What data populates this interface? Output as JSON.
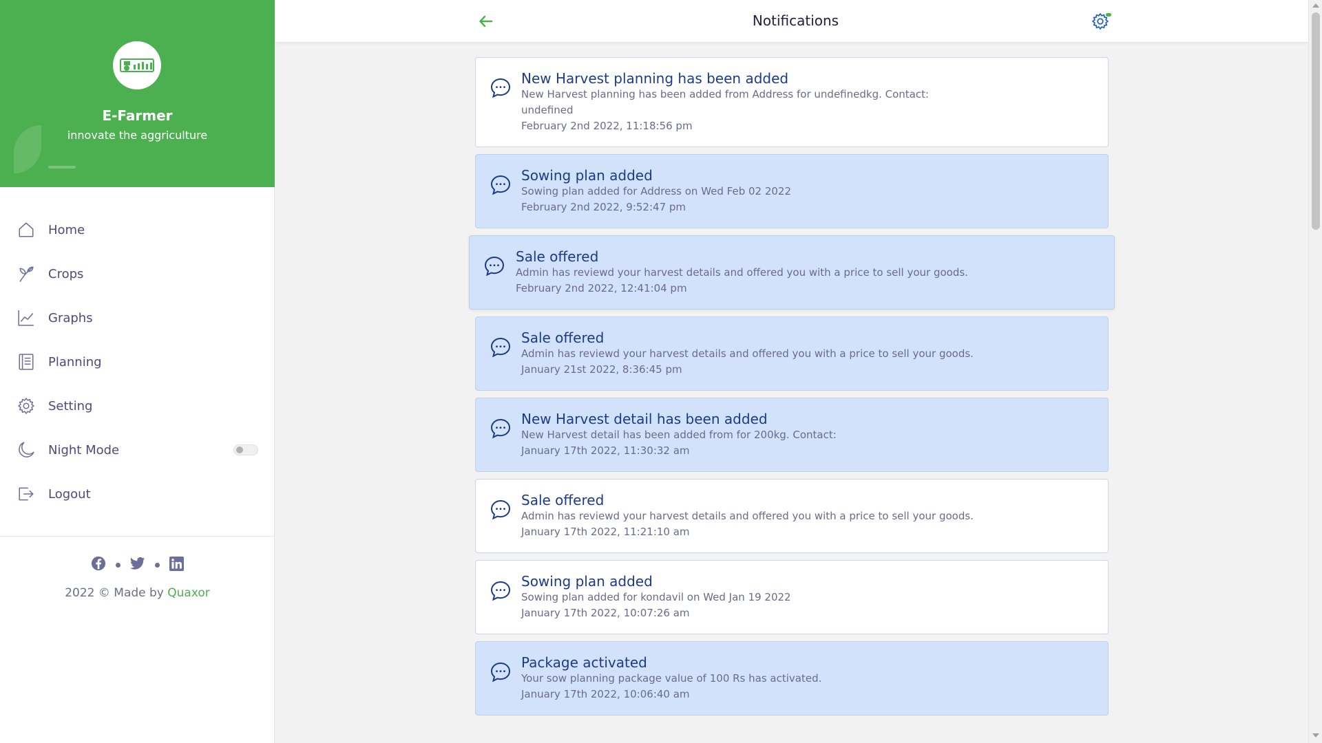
{
  "brand": {
    "name": "E-Farmer",
    "tagline": "innovate the aggriculture"
  },
  "nav": {
    "items": [
      {
        "label": "Home",
        "icon": "home-icon"
      },
      {
        "label": "Crops",
        "icon": "sprout-icon"
      },
      {
        "label": "Graphs",
        "icon": "line-chart-icon"
      },
      {
        "label": "Planning",
        "icon": "list-document-icon"
      },
      {
        "label": "Setting",
        "icon": "gear-icon"
      },
      {
        "label": "Night Mode",
        "icon": "moon-icon",
        "toggle_on": false
      },
      {
        "label": "Logout",
        "icon": "logout-icon"
      }
    ]
  },
  "footer": {
    "socials": [
      "facebook-icon",
      "twitter-icon",
      "linkedin-icon"
    ],
    "copyright_prefix": "2022 © Made by ",
    "company": "Quaxor"
  },
  "header": {
    "title": "Notifications",
    "back_icon": "arrow-left-icon",
    "settings_icon": "gear-icon"
  },
  "colors": {
    "brand_green": "#4caf50",
    "unread_bg": "#d2e2fb",
    "title_blue": "#1b3a8a",
    "nav_text": "#4b4b7e"
  },
  "notifications": [
    {
      "title": "New Harvest planning has been added",
      "message": "New Harvest planning has been added from Address for undefinedkg. Contact: undefined",
      "time": "February 2nd 2022, 11:18:56 pm",
      "unread": false
    },
    {
      "title": "Sowing plan added",
      "message": "Sowing plan added for Address on Wed Feb 02 2022",
      "time": "February 2nd 2022, 9:52:47 pm",
      "unread": true
    },
    {
      "title": "Sale offered",
      "message": "Admin has reviewd your harvest details and offered you with a price to sell your goods.",
      "time": "February 2nd 2022, 12:41:04 pm",
      "unread": true,
      "hovered": true
    },
    {
      "title": "Sale offered",
      "message": "Admin has reviewd your harvest details and offered you with a price to sell your goods.",
      "time": "January 21st 2022, 8:36:45 pm",
      "unread": true
    },
    {
      "title": "New Harvest detail has been added",
      "message": "New Harvest detail has been added from for 200kg. Contact:",
      "time": "January 17th 2022, 11:30:32 am",
      "unread": true
    },
    {
      "title": "Sale offered",
      "message": "Admin has reviewd your harvest details and offered you with a price to sell your goods.",
      "time": "January 17th 2022, 11:21:10 am",
      "unread": false
    },
    {
      "title": "Sowing plan added",
      "message": "Sowing plan added for kondavil on Wed Jan 19 2022",
      "time": "January 17th 2022, 10:07:26 am",
      "unread": false
    },
    {
      "title": "Package activated",
      "message": "Your sow planning package value of 100 Rs has activated.",
      "time": "January 17th 2022, 10:06:40 am",
      "unread": true
    }
  ]
}
